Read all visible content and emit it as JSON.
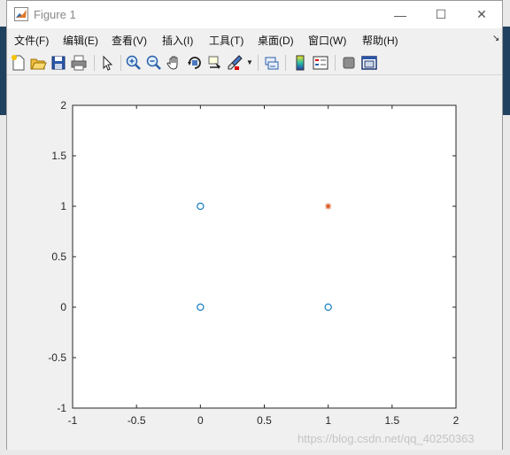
{
  "window": {
    "title": "Figure 1",
    "controls": {
      "minimize": "—",
      "maximize": "☐",
      "close": "✕"
    }
  },
  "menu": {
    "items": [
      "文件(F)",
      "编辑(E)",
      "查看(V)",
      "插入(I)",
      "工具(T)",
      "桌面(D)",
      "窗口(W)",
      "帮助(H)"
    ],
    "overflow": "↘"
  },
  "toolbar": {
    "icons": [
      "new-figure-icon",
      "open-file-icon",
      "save-icon",
      "print-icon",
      "pointer-icon",
      "zoom-in-icon",
      "zoom-out-icon",
      "pan-icon",
      "rotate-3d-icon",
      "data-cursor-icon",
      "brush-icon",
      "brush-dropdown-icon",
      "link-plot-icon",
      "colorbar-icon",
      "legend-icon",
      "hide-plot-tools-icon",
      "show-plot-tools-icon"
    ]
  },
  "chart_data": {
    "type": "scatter",
    "title": "",
    "xlabel": "",
    "ylabel": "",
    "xlim": [
      -1,
      2
    ],
    "ylim": [
      -1,
      2
    ],
    "xticks": [
      "-1",
      "-0.5",
      "0",
      "0.5",
      "1",
      "1.5",
      "2"
    ],
    "yticks": [
      "2",
      "1.5",
      "1",
      "0.5",
      "0",
      "-0.5",
      "-1"
    ],
    "grid": false,
    "series": [
      {
        "marker": "o",
        "color": "#0072bd",
        "points": [
          [
            0,
            0
          ],
          [
            0,
            1
          ],
          [
            1,
            0
          ]
        ]
      },
      {
        "marker": "*",
        "color": "#d95319",
        "points": [
          [
            1,
            1
          ]
        ]
      }
    ]
  },
  "watermark": "https://blog.csdn.net/qq_40250363"
}
